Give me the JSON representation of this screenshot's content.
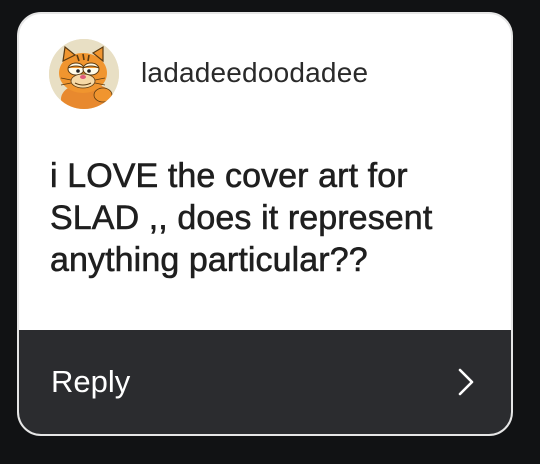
{
  "message_card": {
    "username": "ladadeedoodadee",
    "avatar_icon": "garfield-avatar-icon",
    "message": "i LOVE the cover art for SLAD ,, does it represent anything particular??",
    "reply_label": "Reply",
    "reply_icon": "chevron-right-icon"
  },
  "colors": {
    "background": "#111214",
    "card": "#ffffff",
    "card_border": "#e6e6e6",
    "reply_bar": "#2b2c2f",
    "text": "#1f1f1f"
  }
}
